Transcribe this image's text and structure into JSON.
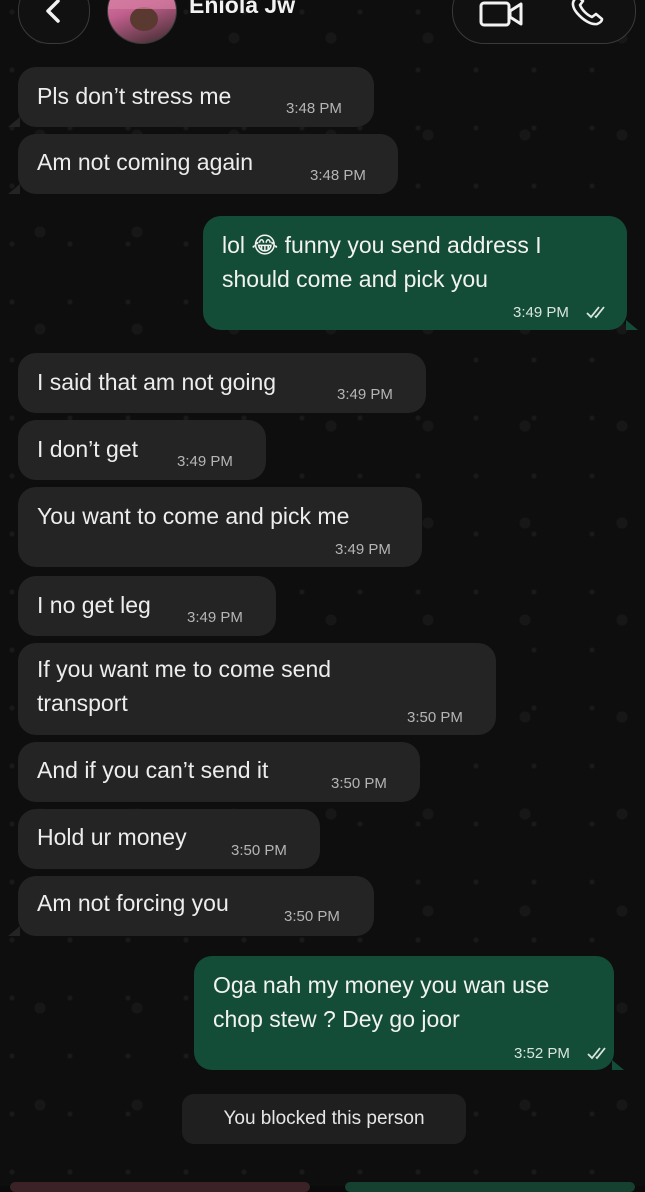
{
  "header": {
    "contact_name": "Eniola Jw",
    "back_icon": "chevron-left-icon",
    "video_icon": "video-camera-icon",
    "phone_icon": "phone-icon"
  },
  "messages": [
    {
      "direction": "incoming",
      "text": "Pls don’t stress me",
      "time": "3:48 PM"
    },
    {
      "direction": "incoming",
      "text": "Am not coming again",
      "time": "3:48 PM"
    },
    {
      "direction": "outgoing",
      "text": "lol 😂 funny you send address I\nshould come and pick you",
      "time": "3:49 PM",
      "status": "read"
    },
    {
      "direction": "incoming",
      "text": "I said that am not going",
      "time": "3:49 PM"
    },
    {
      "direction": "incoming",
      "text": "I don’t get",
      "time": "3:49 PM"
    },
    {
      "direction": "incoming",
      "text": "You want to come and pick me",
      "time": "3:49 PM"
    },
    {
      "direction": "incoming",
      "text": "I no get leg",
      "time": "3:49 PM"
    },
    {
      "direction": "incoming",
      "text": "If you want me to come send\ntransport",
      "time": "3:50 PM"
    },
    {
      "direction": "incoming",
      "text": "And if you can’t send it",
      "time": "3:50 PM"
    },
    {
      "direction": "incoming",
      "text": "Hold ur money",
      "time": "3:50 PM"
    },
    {
      "direction": "incoming",
      "text": "Am not forcing you",
      "time": "3:50 PM"
    },
    {
      "direction": "outgoing",
      "text": "Oga nah my money you wan use\nchop stew ? Dey go joor",
      "time": "3:52 PM",
      "status": "read"
    }
  ],
  "system_notice": "You blocked this person",
  "colors": {
    "background": "#0e0e0e",
    "incoming_bubble": "#242424",
    "outgoing_bubble": "#144d37"
  }
}
